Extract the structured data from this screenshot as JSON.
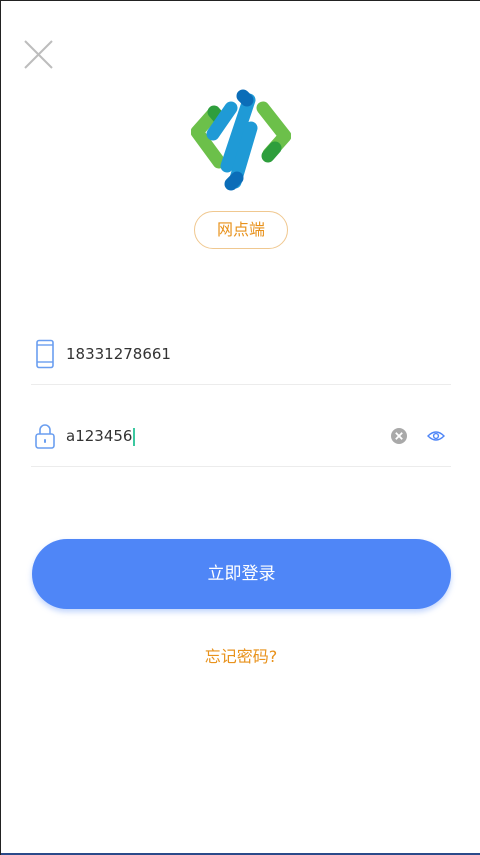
{
  "header": {
    "close_icon": "close-icon"
  },
  "logo": {
    "icon": "app-logo-icon",
    "colors": [
      "#6cc04a",
      "#1f9ad6",
      "#0b6db8",
      "#2e9e3c"
    ]
  },
  "role_badge": {
    "label": "网点端",
    "color": "#e8921c"
  },
  "form": {
    "phone": {
      "icon": "phone-icon",
      "value": "18331278661"
    },
    "password": {
      "icon": "lock-icon",
      "value": "a123456",
      "clear_icon": "clear-icon",
      "toggle_icon": "eye-icon"
    }
  },
  "actions": {
    "login_label": "立即登录",
    "forgot_label": "忘记密码?",
    "accent_color": "#4f86f7"
  }
}
